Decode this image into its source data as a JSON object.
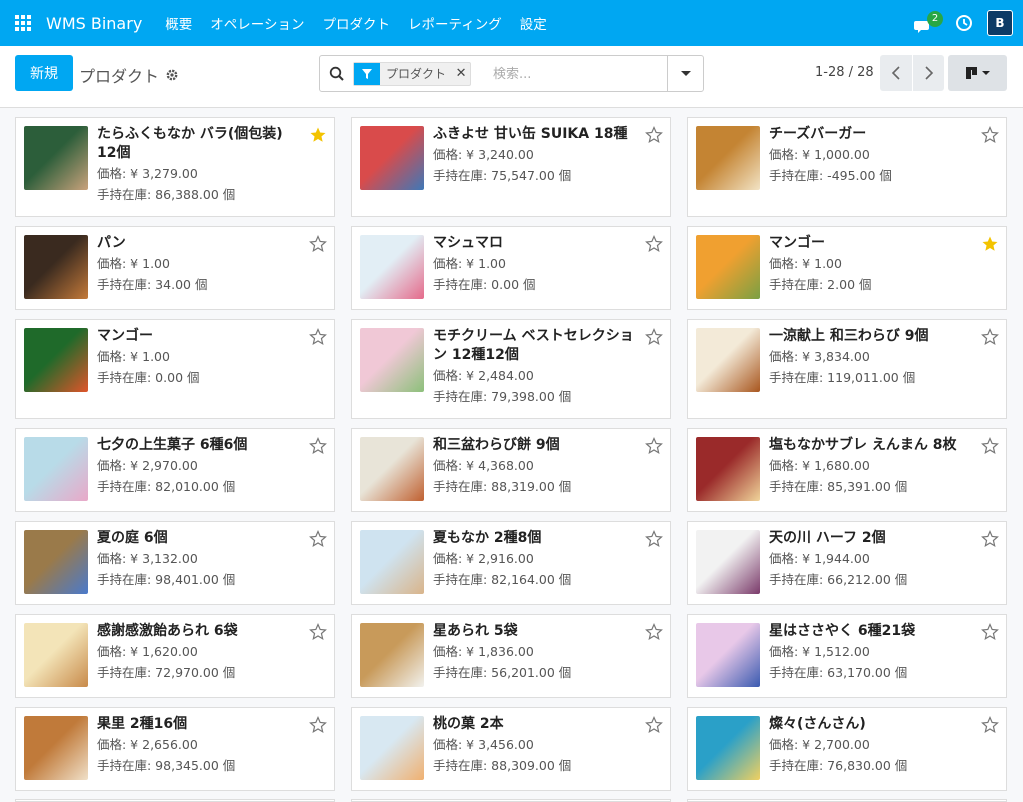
{
  "app": {
    "brand": "WMS Binary"
  },
  "menu": [
    "概要",
    "オペレーション",
    "プロダクト",
    "レポーティング",
    "設定"
  ],
  "notifications": {
    "count": "2"
  },
  "user": {
    "initial": "B"
  },
  "control": {
    "new_label": "新規",
    "breadcrumb": "プロダクト",
    "facet_label": "プロダクト",
    "search_placeholder": "検索...",
    "pager": "1-28 / 28"
  },
  "colors": {
    "brand": "#00a7f2",
    "star_active": "#f3c300",
    "star_inactive": "#777777"
  },
  "products": [
    {
      "name": "たらふくもなか バラ(個包装) 12個",
      "price": "価格: ¥ 3,279.00",
      "stock": "手持在庫: 86,388.00 個",
      "favorite": true,
      "colors": [
        "#2c5e3a",
        "#c9a27c"
      ]
    },
    {
      "name": "ふきよせ 甘い缶 SUIKA 18種",
      "price": "価格: ¥ 3,240.00",
      "stock": "手持在庫: 75,547.00 個",
      "favorite": false,
      "colors": [
        "#d94b4b",
        "#3e78b8"
      ]
    },
    {
      "name": "チーズバーガー",
      "price": "価格: ¥ 1,000.00",
      "stock": "手持在庫: -495.00 個",
      "favorite": false,
      "colors": [
        "#c48433",
        "#f2e3c4"
      ]
    },
    {
      "name": "パン",
      "price": "価格: ¥ 1.00",
      "stock": "手持在庫: 34.00 個",
      "favorite": false,
      "colors": [
        "#3a2a1f",
        "#c47a3a"
      ]
    },
    {
      "name": "マシュマロ",
      "price": "価格: ¥ 1.00",
      "stock": "手持在庫: 0.00 個",
      "favorite": false,
      "colors": [
        "#e2eef5",
        "#e56a8a"
      ]
    },
    {
      "name": "マンゴー",
      "price": "価格: ¥ 1.00",
      "stock": "手持在庫: 2.00 個",
      "favorite": true,
      "colors": [
        "#f0a030",
        "#7aa043"
      ]
    },
    {
      "name": "マンゴー",
      "price": "価格: ¥ 1.00",
      "stock": "手持在庫: 0.00 個",
      "favorite": false,
      "colors": [
        "#1f6a2a",
        "#e0552a"
      ]
    },
    {
      "name": "モチクリーム ベストセレクション 12種12個",
      "price": "価格: ¥ 2,484.00",
      "stock": "手持在庫: 79,398.00 個",
      "favorite": false,
      "colors": [
        "#f0c8d6",
        "#8cc07a"
      ]
    },
    {
      "name": "一涼献上 和三わらび 9個",
      "price": "価格: ¥ 3,834.00",
      "stock": "手持在庫: 119,011.00 個",
      "favorite": false,
      "colors": [
        "#f3ead8",
        "#a8561e"
      ]
    },
    {
      "name": "七夕の上生菓子 6種6個",
      "price": "価格: ¥ 2,970.00",
      "stock": "手持在庫: 82,010.00 個",
      "favorite": false,
      "colors": [
        "#b8dbe8",
        "#e9a8c8"
      ]
    },
    {
      "name": "和三盆わらび餅 9個",
      "price": "価格: ¥ 4,368.00",
      "stock": "手持在庫: 88,319.00 個",
      "favorite": false,
      "colors": [
        "#e8e4d8",
        "#c06030"
      ]
    },
    {
      "name": "塩もなかサブレ えんまん 8枚",
      "price": "価格: ¥ 1,680.00",
      "stock": "手持在庫: 85,391.00 個",
      "favorite": false,
      "colors": [
        "#9a2a2a",
        "#f0d49a"
      ]
    },
    {
      "name": "夏の庭 6個",
      "price": "価格: ¥ 3,132.00",
      "stock": "手持在庫: 98,401.00 個",
      "favorite": false,
      "colors": [
        "#9a7a4a",
        "#4a7acc"
      ]
    },
    {
      "name": "夏もなか 2種8個",
      "price": "価格: ¥ 2,916.00",
      "stock": "手持在庫: 82,164.00 個",
      "favorite": false,
      "colors": [
        "#cfe3f0",
        "#d9b48a"
      ]
    },
    {
      "name": "天の川 ハーフ 2個",
      "price": "価格: ¥ 1,944.00",
      "stock": "手持在庫: 66,212.00 個",
      "favorite": false,
      "colors": [
        "#f2f2f2",
        "#7a3a6a"
      ]
    },
    {
      "name": "感謝感激飴あられ 6袋",
      "price": "価格: ¥ 1,620.00",
      "stock": "手持在庫: 72,970.00 個",
      "favorite": false,
      "colors": [
        "#f3e4b8",
        "#c88a4a"
      ]
    },
    {
      "name": "星あられ 5袋",
      "price": "価格: ¥ 1,836.00",
      "stock": "手持在庫: 56,201.00 個",
      "favorite": false,
      "colors": [
        "#c89a5a",
        "#f2f2ee"
      ]
    },
    {
      "name": "星はささやく 6種21袋",
      "price": "価格: ¥ 1,512.00",
      "stock": "手持在庫: 63,170.00 個",
      "favorite": false,
      "colors": [
        "#e8c8e8",
        "#3a5ab0"
      ]
    },
    {
      "name": "果里 2種16個",
      "price": "価格: ¥ 2,656.00",
      "stock": "手持在庫: 98,345.00 個",
      "favorite": false,
      "colors": [
        "#c07a3a",
        "#f0e0c8"
      ]
    },
    {
      "name": "桃の菓 2本",
      "price": "価格: ¥ 3,456.00",
      "stock": "手持在庫: 88,309.00 個",
      "favorite": false,
      "colors": [
        "#d8e8f2",
        "#f0b070"
      ]
    },
    {
      "name": "燦々(さんさん)",
      "price": "価格: ¥ 2,700.00",
      "stock": "手持在庫: 76,830.00 個",
      "favorite": false,
      "colors": [
        "#2aa0c8",
        "#f0d060"
      ]
    }
  ]
}
